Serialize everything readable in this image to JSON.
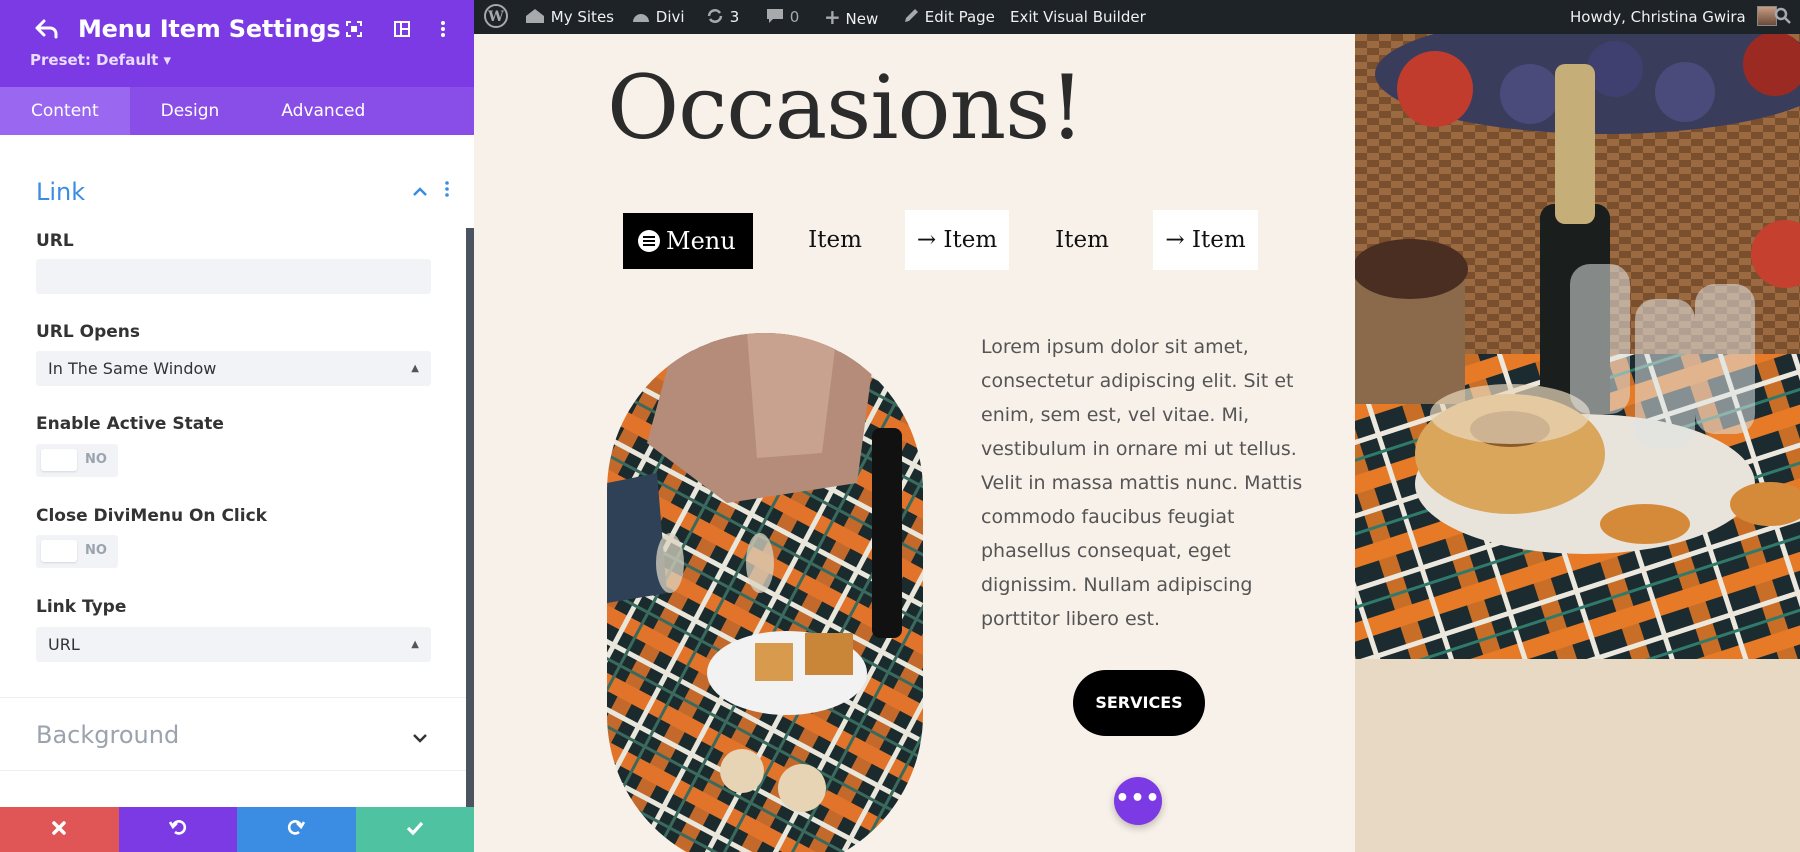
{
  "panel": {
    "title": "Menu Item Settings",
    "preset": "Preset: Default ▾",
    "tabs": [
      {
        "label": "Content",
        "active": true
      },
      {
        "label": "Design",
        "active": false
      },
      {
        "label": "Advanced",
        "active": false
      }
    ],
    "section_link": "Link",
    "url_label": "URL",
    "url_value": "",
    "url_opens_label": "URL Opens",
    "url_opens_value": "In The Same Window",
    "active_state_label": "Enable Active State",
    "active_state_value": "NO",
    "close_menu_label": "Close DiviMenu On Click",
    "close_menu_value": "NO",
    "link_type_label": "Link Type",
    "link_type_value": "URL",
    "section_background": "Background",
    "colors": {
      "header": "#7b3ae3",
      "link_section": "#3b8ce3",
      "background_section": "#9aa3ae",
      "cancel": "#e05555",
      "undo": "#7b3ae3",
      "redo": "#3b8ce3",
      "save": "#4fc3a1"
    }
  },
  "adminbar": {
    "my_sites": "My Sites",
    "divi": "Divi",
    "updates": "3",
    "comments": "0",
    "new": "New",
    "edit_page": "Edit Page",
    "exit_builder": "Exit Visual Builder",
    "howdy": "Howdy, Christina Gwira"
  },
  "canvas": {
    "heading": "Occasions!",
    "menu_button": "Menu",
    "menu_items": [
      "Item",
      "→ Item",
      "Item",
      "→ Item"
    ],
    "body_text": "Lorem ipsum dolor sit amet, consectetur adipiscing elit. Sit et enim, sem est, vel vitae. Mi, vestibulum in ornare mi ut tellus. Velit in massa mattis nunc. Mattis commodo faucibus feugiat phasellus consequat, eget dignissim. Nullam adipiscing porttitor libero est.",
    "services_button": "SERVICES",
    "more_button": "•••"
  }
}
